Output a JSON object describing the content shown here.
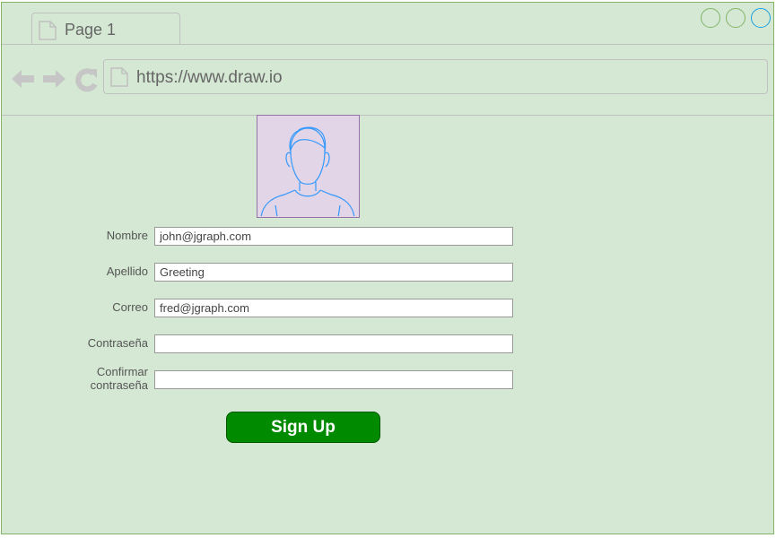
{
  "browser": {
    "tab_label": "Page 1",
    "url": "https://www.draw.io",
    "window_controls": [
      "minimize",
      "maximize",
      "close"
    ]
  },
  "form": {
    "fields": [
      {
        "label": "Nombre",
        "value": "john@jgraph.com"
      },
      {
        "label": "Apellido",
        "value": "Greeting"
      },
      {
        "label": "Correo",
        "value": "fred@jgraph.com"
      },
      {
        "label": "Contraseña",
        "value": ""
      },
      {
        "label_line1": "Confirmar",
        "label_line2": "contraseña",
        "value": ""
      }
    ],
    "submit_label": "Sign Up"
  },
  "colors": {
    "background": "#d5e8d4",
    "frame_border": "#82b366",
    "avatar_fill": "#e1d5e7",
    "avatar_border": "#9673a6",
    "avatar_stroke": "#3399ff",
    "button_fill": "#008a00"
  }
}
